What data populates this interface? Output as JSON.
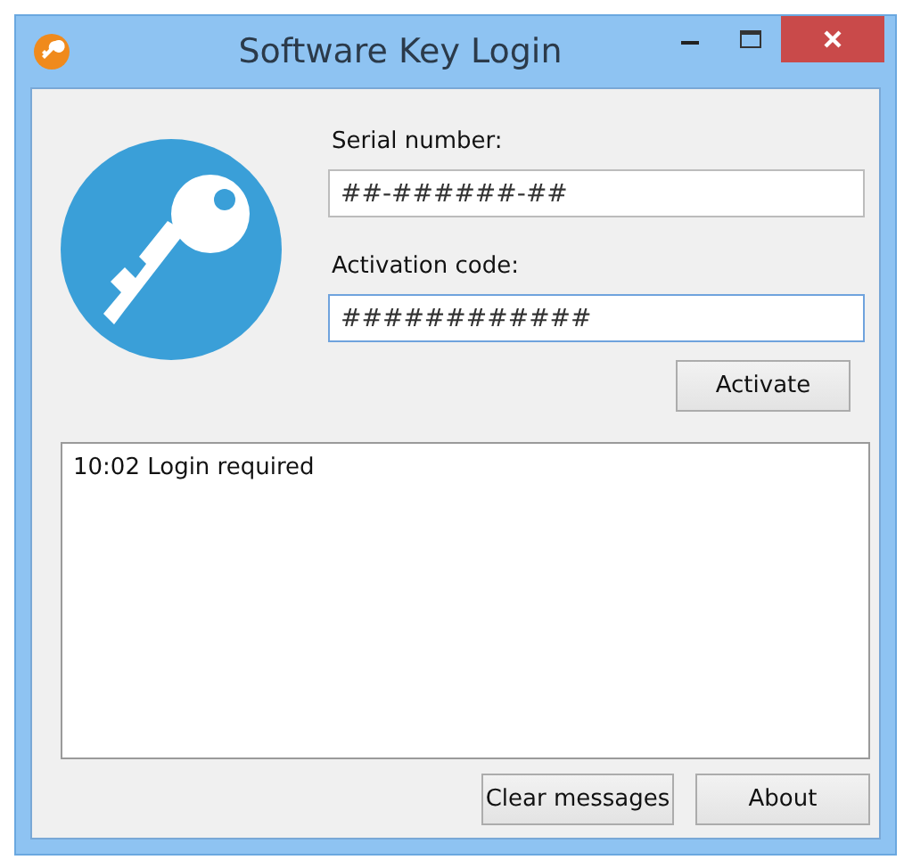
{
  "window": {
    "title": "Software Key Login"
  },
  "fields": [
    {
      "label": "Serial number:",
      "value": "##-######-##",
      "focused": false
    },
    {
      "label": "Activation code:",
      "value": "############",
      "focused": true
    }
  ],
  "activate_button": "Activate",
  "messages": [
    "10:02 Login required"
  ],
  "buttons": [
    "Clear messages",
    "About"
  ]
}
